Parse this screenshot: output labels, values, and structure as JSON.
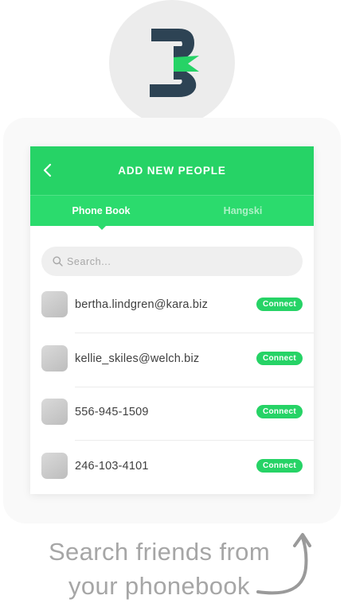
{
  "app_logo": {
    "icon": "three-logo-icon",
    "colors": {
      "dark": "#2d4354",
      "accent": "#26d366",
      "circle": "#ececec"
    }
  },
  "screen": {
    "title": "ADD NEW PEOPLE",
    "back_icon": "back-chevron-icon",
    "tabs": [
      {
        "label": "Phone Book",
        "active": true
      },
      {
        "label": "Hangski",
        "active": false
      }
    ],
    "search": {
      "placeholder": "Search...",
      "value": ""
    },
    "contacts": [
      {
        "name": "bertha.lindgren@kara.biz",
        "action": "Connect"
      },
      {
        "name": "kellie_skiles@welch.biz",
        "action": "Connect"
      },
      {
        "name": "556-945-1509",
        "action": "Connect"
      },
      {
        "name": "246-103-4101",
        "action": "Connect"
      }
    ],
    "colors": {
      "primary": "#26d366",
      "tab_bar": "#2bdb6d"
    }
  },
  "caption": {
    "line1": "Search friends from",
    "line2": "your phonebook",
    "arrow_icon": "curved-up-arrow-icon"
  }
}
